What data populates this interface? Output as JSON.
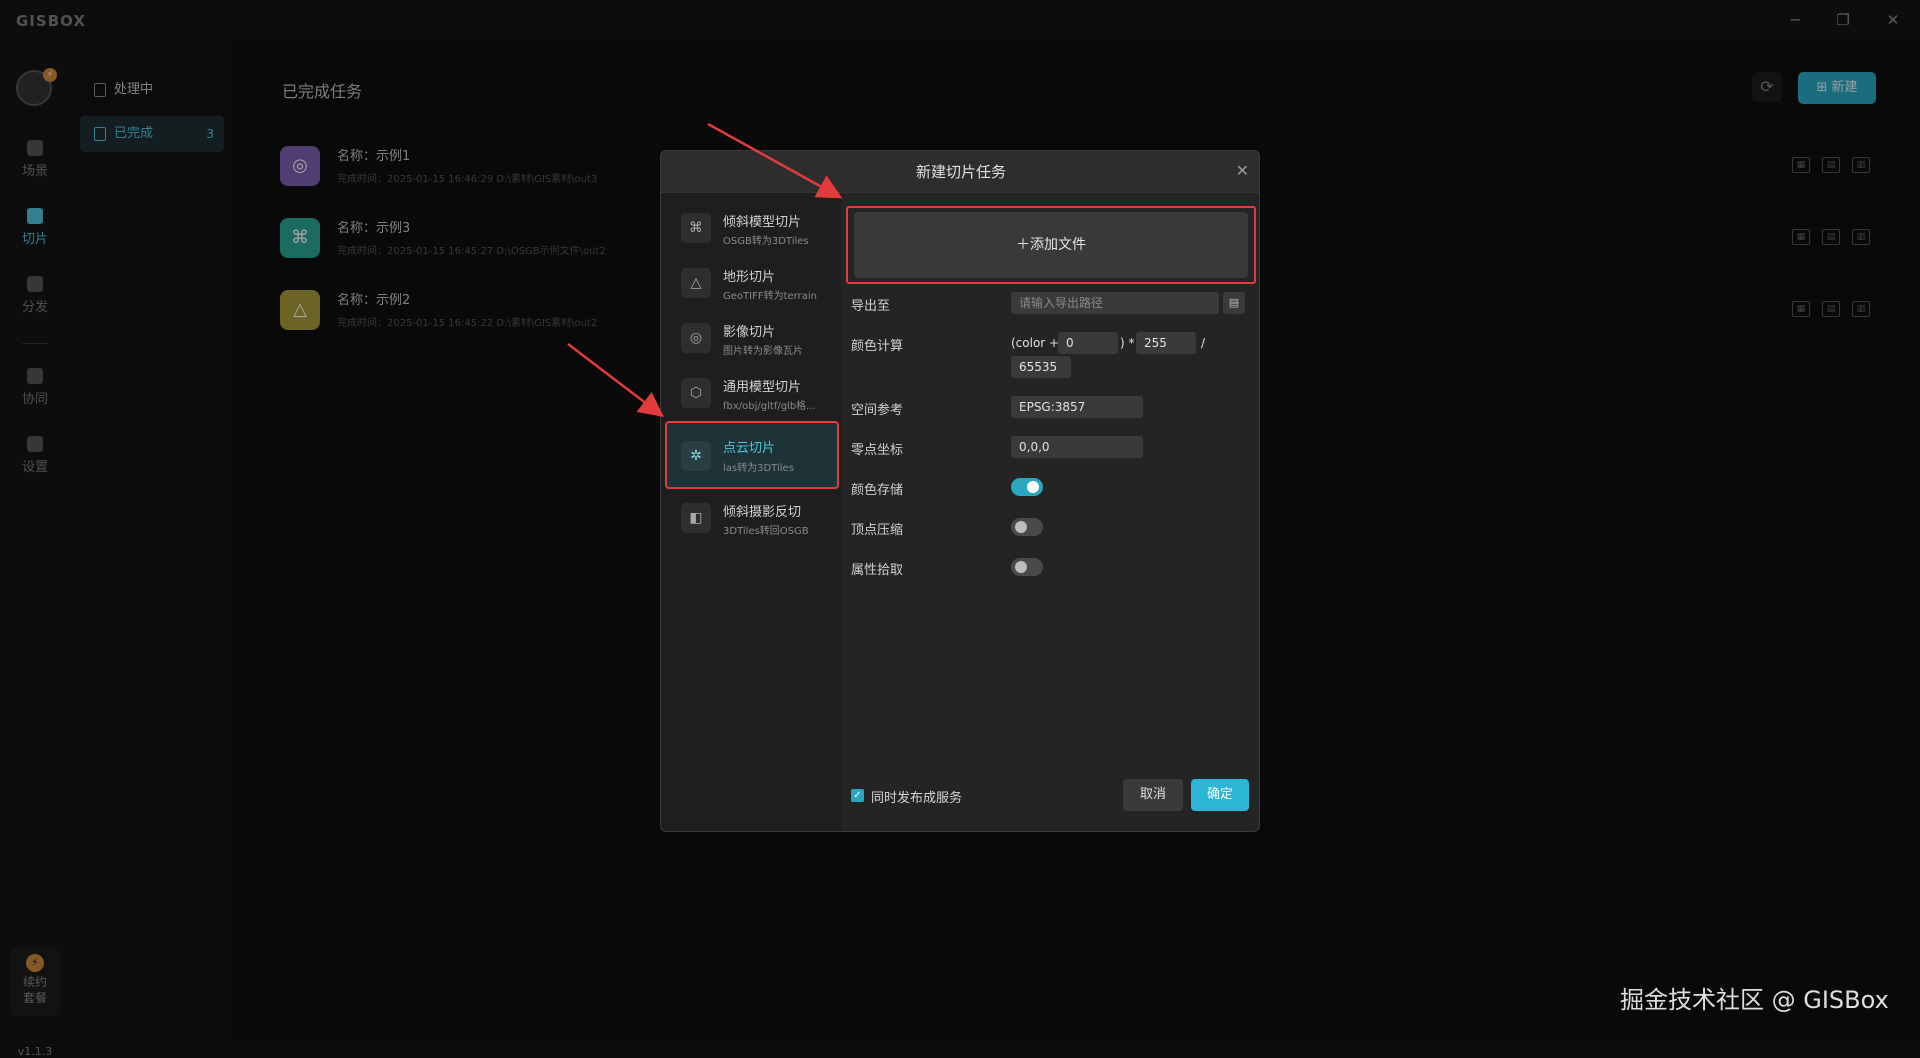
{
  "app": {
    "logo": "GISBOX",
    "window_controls": [
      "─",
      "❐",
      "✕"
    ]
  },
  "leftbar": {
    "badge": "⚡",
    "items": [
      {
        "label": "场景",
        "icon": "home-icon"
      },
      {
        "label": "切片",
        "icon": "slice-icon"
      },
      {
        "label": "分发",
        "icon": "share-icon"
      },
      {
        "label": "协同",
        "icon": "collab-icon"
      },
      {
        "label": "设置",
        "icon": "settings-icon"
      }
    ],
    "renew_label_1": "续约",
    "renew_label_2": "套餐",
    "version": "v1.1.3"
  },
  "status_nav": {
    "processing": "处理中",
    "done": "已完成",
    "done_count": "3"
  },
  "main": {
    "title": "已完成任务",
    "new_button": "新建",
    "tasks": [
      {
        "name": "名称：示例1",
        "meta": "完成时间：2025-01-15 16:46:29    D:\\素材\\GIS素材\\out3",
        "color": "#7b5fb0"
      },
      {
        "name": "名称：示例3",
        "meta": "完成时间：2025-01-15 16:45:27    D:\\OSGB示例文件\\out2",
        "color": "#2aa596"
      },
      {
        "name": "名称：示例2",
        "meta": "完成时间：2025-01-15 16:45:22    D:\\素材\\GIS素材\\out2",
        "color": "#a59a3a"
      }
    ]
  },
  "modal": {
    "title": "新建切片任务",
    "close": "✕",
    "types": [
      {
        "title": "倾斜模型切片",
        "sub": "OSGB转为3DTiles"
      },
      {
        "title": "地形切片",
        "sub": "GeoTIFF转为terrain"
      },
      {
        "title": "影像切片",
        "sub": "图片转为影像瓦片"
      },
      {
        "title": "通用模型切片",
        "sub": "fbx/obj/gltf/glb格..."
      },
      {
        "title": "点云切片",
        "sub": "las转为3DTiles"
      },
      {
        "title": "倾斜摄影反切",
        "sub": "3DTiles转回OSGB"
      }
    ],
    "add_file": "＋添加文件",
    "export_label": "导出至",
    "export_placeholder": "请输入导出路径",
    "color_calc_label": "颜色计算",
    "color_prefix": "(color +",
    "color_offset": "0",
    "color_mid": ") *",
    "color_mult": "255",
    "color_div_sign": "/",
    "color_div": "65535",
    "spatial_label": "空间参考",
    "spatial_value": "EPSG:3857",
    "origin_label": "零点坐标",
    "origin_value": "0,0,0",
    "color_store_label": "颜色存储",
    "vertex_compress_label": "顶点压缩",
    "attr_pick_label": "属性拾取",
    "publish_label": "同时发布成服务",
    "cancel": "取消",
    "ok": "确定"
  },
  "watermark": "掘金技术社区 @ GISBox"
}
